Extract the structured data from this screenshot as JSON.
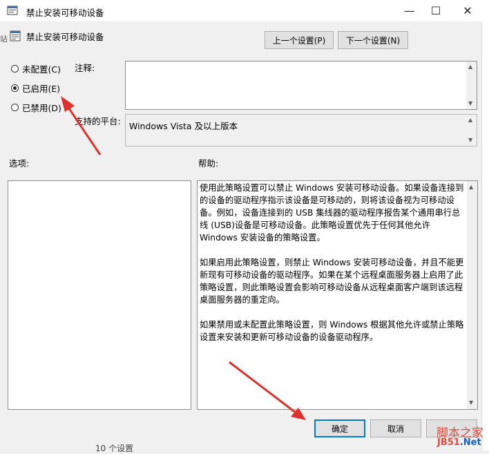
{
  "window": {
    "title": "禁止安装可移动设备",
    "minimize": "—",
    "maximize": "☐",
    "close": "✕"
  },
  "header": {
    "policy_name": "禁止安装可移动设备"
  },
  "nav": {
    "prev_label": "上一个设置(P)",
    "next_label": "下一个设置(N)"
  },
  "state_options": [
    {
      "label": "未配置(C)",
      "checked": false
    },
    {
      "label": "已启用(E)",
      "checked": true
    },
    {
      "label": "已禁用(D)",
      "checked": false
    }
  ],
  "comment": {
    "label": "注释:",
    "value": ""
  },
  "platform": {
    "label": "支持的平台:",
    "value": "Windows Vista 及以上版本"
  },
  "options_label": "选项:",
  "help_label": "帮助:",
  "help_paragraphs": [
    "使用此策略设置可以禁止 Windows 安装可移动设备。如果设备连接到的设备的驱动程序指示该设备是可移动的，则将该设备视为可移动设备。例如，设备连接到的 USB 集线器的驱动程序报告某个通用串行总线 (USB)设备是可移动设备。此策略设置优先于任何其他允许 Windows 安装设备的策略设置。",
    "如果启用此策略设置，则禁止 Windows 安装可移动设备，并且不能更新现有可移动设备的驱动程序。如果在某个远程桌面服务器上启用了此策略设置，则此策略设置会影响可移动设备从远程桌面客户端到该远程桌面服务器的重定向。",
    "如果禁用或未配置此策略设置，则 Windows 根据其他允许或禁止策略设置来安装和更新可移动设备的设备驱动程序。"
  ],
  "footer": {
    "ok_label": "确定",
    "cancel_label": "取消"
  },
  "watermark": {
    "line1": "脚本之家",
    "line2_a": "JB51",
    "line2_b": ".Net"
  },
  "background_text": {
    "left_sliver": "站",
    "bottom_sliver": "10 个设置"
  },
  "colors": {
    "annotation_arrow": "#e0302a",
    "focus_border": "#0078d7"
  }
}
